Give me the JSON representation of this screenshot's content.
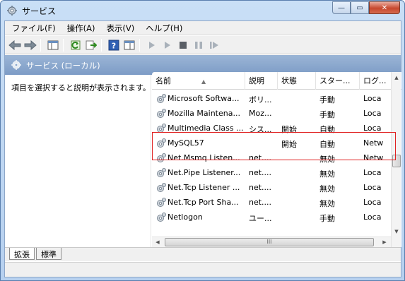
{
  "window": {
    "title": "サービス",
    "buttons": {
      "minimize": "—",
      "maximize": "▭",
      "close": "✕"
    }
  },
  "menu": [
    "ファイル(F)",
    "操作(A)",
    "表示(V)",
    "ヘルプ(H)"
  ],
  "toolbar_icons": [
    "back-icon",
    "forward-icon",
    "console-tree-icon",
    "refresh-icon",
    "export-icon",
    "help-icon",
    "properties-icon",
    "start-icon",
    "start-alt-icon",
    "stop-icon",
    "pause-icon",
    "restart-icon"
  ],
  "pane": {
    "header": "サービス (ローカル)",
    "description": "項目を選択すると説明が表示されます。"
  },
  "columns": [
    "名前",
    "説明",
    "状態",
    "スター...",
    "ログ..."
  ],
  "rows": [
    {
      "name": "Microsoft Softwa...",
      "desc": "ボリ...",
      "status": "",
      "startup": "手動",
      "logon": "Loca"
    },
    {
      "name": "Mozilla Maintena...",
      "desc": "Moz...",
      "status": "",
      "startup": "手動",
      "logon": "Loca"
    },
    {
      "name": "Multimedia Class ...",
      "desc": "シス...",
      "status": "開始",
      "startup": "自動",
      "logon": "Loca"
    },
    {
      "name": "MySQL57",
      "desc": "",
      "status": "開始",
      "startup": "自動",
      "logon": "Netw"
    },
    {
      "name": "Net.Msmq Listen...",
      "desc": "net....",
      "status": "",
      "startup": "無効",
      "logon": "Netw"
    },
    {
      "name": "Net.Pipe Listener...",
      "desc": "net....",
      "status": "",
      "startup": "無効",
      "logon": "Loca"
    },
    {
      "name": "Net.Tcp Listener ...",
      "desc": "net....",
      "status": "",
      "startup": "無効",
      "logon": "Loca"
    },
    {
      "name": "Net.Tcp Port Sha...",
      "desc": "net....",
      "status": "",
      "startup": "無効",
      "logon": "Loca"
    },
    {
      "name": "Netlogon",
      "desc": "ユー...",
      "status": "",
      "startup": "手動",
      "logon": "Loca"
    }
  ],
  "tabs": [
    "拡張",
    "標準"
  ],
  "scrollbar": {
    "grip": "III"
  },
  "colors": {
    "highlight": "#e02020",
    "header": "#8aa8ce"
  }
}
